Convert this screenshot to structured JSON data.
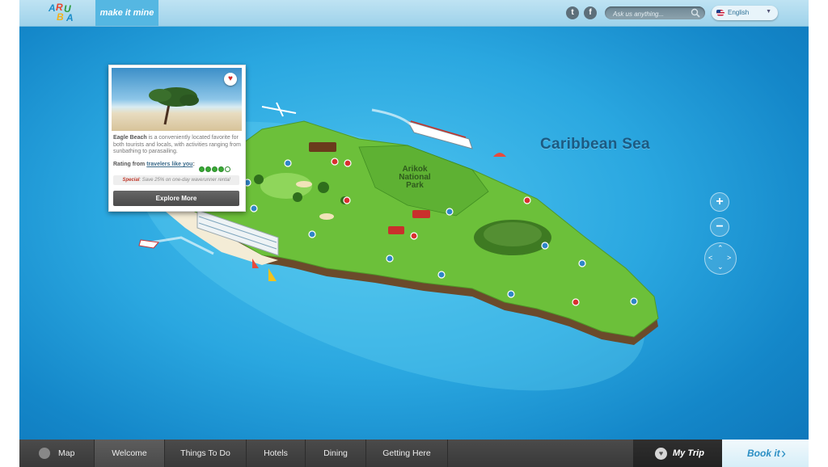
{
  "brand": {
    "logo_text": "ARUBA",
    "tagline": "make it mine"
  },
  "header": {
    "social": [
      {
        "icon": "twitter-icon",
        "glyph": "t"
      },
      {
        "icon": "facebook-icon",
        "glyph": "f"
      }
    ],
    "search": {
      "placeholder": "Ask us anything..."
    },
    "language": {
      "selected": "English",
      "icon": "us-flag-icon"
    }
  },
  "map": {
    "sea_label": "Caribbean Sea",
    "park_label_lines": [
      "Arikok",
      "National",
      "Park"
    ],
    "controls": {
      "zoom_in": "+",
      "zoom_out": "−"
    }
  },
  "popup": {
    "place_name": "Eagle Beach",
    "description": " is a conveniently located favorite for both tourists and locals, with activities ranging from sunbathing to parasailing.",
    "rating_label_prefix": "Rating from ",
    "rating_label_link": "travelers like you",
    "rating_label_suffix": ":",
    "rating": 4,
    "rating_max": 5,
    "special_label": "Special",
    "special_text": ": Save 25% on one-day waverunner rental",
    "button": "Explore More"
  },
  "nav": {
    "map": "Map",
    "items": [
      "Welcome",
      "Things To Do",
      "Hotels",
      "Dining",
      "Getting Here"
    ],
    "active": "Welcome",
    "my_trip": "My Trip",
    "book_it": "Book it"
  },
  "colors": {
    "sea": "#2aa7e0",
    "island": "#6cc03a",
    "pin_red": "#d83030",
    "pin_blue": "#2f86c8",
    "nav_bg": "#3f3f3f",
    "accent": "#2b8fc4"
  }
}
